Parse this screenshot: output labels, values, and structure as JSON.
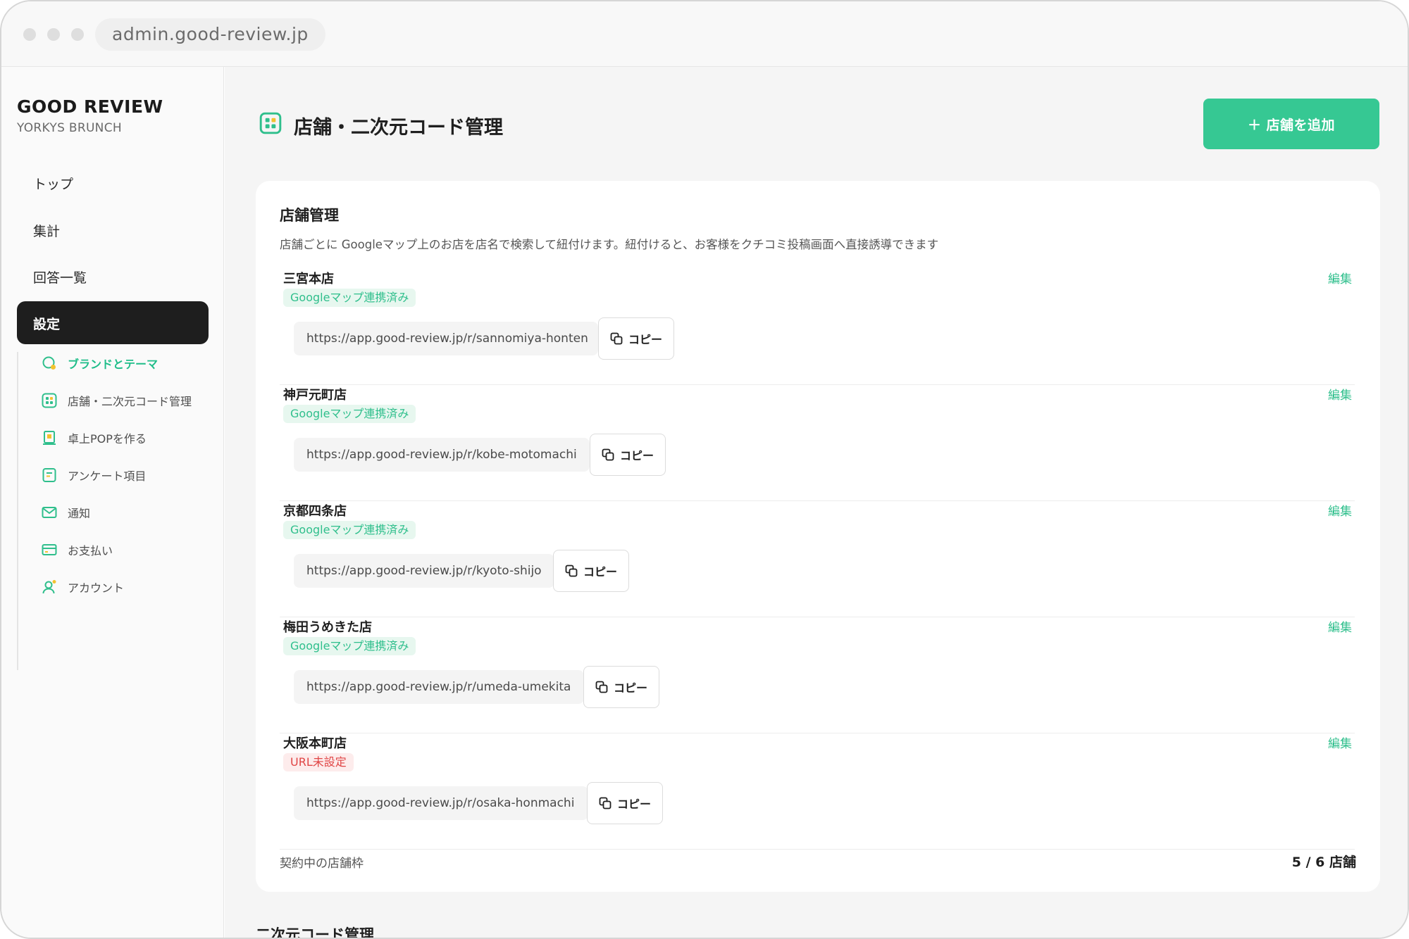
{
  "browser": {
    "url": "admin.good-review.jp"
  },
  "brand": {
    "title": "GOOD REVIEW",
    "subtitle": "YORKYS BRUNCH"
  },
  "nav": {
    "items": [
      {
        "label": "トップ"
      },
      {
        "label": "集計"
      },
      {
        "label": "回答一覧"
      }
    ],
    "active": {
      "label": "設定"
    },
    "sub_items": [
      {
        "label": "ブランドとテーマ",
        "icon": "brand-theme-icon"
      },
      {
        "label": "店舗・二次元コード管理",
        "icon": "grid-qr-icon"
      },
      {
        "label": "卓上POPを作る",
        "icon": "pop-icon"
      },
      {
        "label": "アンケート項目",
        "icon": "survey-icon"
      },
      {
        "label": "通知",
        "icon": "mail-icon"
      },
      {
        "label": "お支払い",
        "icon": "card-icon"
      },
      {
        "label": "アカウント",
        "icon": "user-icon"
      }
    ]
  },
  "header": {
    "title": "店舗・二次元コード管理",
    "add_button": "＋ 店舗を追加"
  },
  "stores_card": {
    "title": "店舗管理",
    "description": "店舗ごとに Googleマップ上のお店を店名で検索して紐付けます。紐付けると、お客様をクチコミ投稿画面へ直接誘導できます",
    "edit_label": "編集",
    "copy_label": "コピー",
    "stores": [
      {
        "name": "三宮本店",
        "status": "Googleマップ連携済み",
        "linked": true,
        "url": "https://app.good-review.jp/r/sannomiya-honten"
      },
      {
        "name": "神戸元町店",
        "status": "Googleマップ連携済み",
        "linked": true,
        "url": "https://app.good-review.jp/r/kobe-motomachi"
      },
      {
        "name": "京都四条店",
        "status": "Googleマップ連携済み",
        "linked": true,
        "url": "https://app.good-review.jp/r/kyoto-shijo"
      },
      {
        "name": "梅田うめきた店",
        "status": "Googleマップ連携済み",
        "linked": true,
        "url": "https://app.good-review.jp/r/umeda-umekita"
      },
      {
        "name": "大阪本町店",
        "status": "URL未設定",
        "linked": false,
        "url": "https://app.good-review.jp/r/osaka-honmachi"
      }
    ],
    "footer_label": "契約中の店舗枠",
    "footer_count": "5 / 6 店舗"
  },
  "qr_section": {
    "title": "二次元コード管理"
  },
  "colors": {
    "accent": "#36c893",
    "accent_text": "#2fbf8c",
    "warning": "#e04545",
    "active_nav": "#1e1e1e"
  }
}
